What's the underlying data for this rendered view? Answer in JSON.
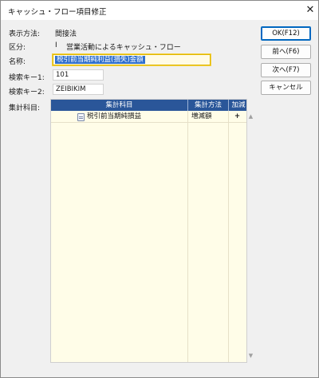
{
  "window": {
    "title": "キャッシュ・フロー項目修正",
    "close_label": "✕"
  },
  "form": {
    "display_method_label": "表示方法:",
    "display_method_value": "間接法",
    "category_label": "区分:",
    "category_code": "I",
    "category_value": "営業活動によるキャッシュ・フロー",
    "name_label": "名称:",
    "name_value": "税引前当期純利益(損失)金額",
    "search_key1_label": "検索キー1:",
    "search_key1_value": "101",
    "search_key2_label": "検索キー2:",
    "search_key2_value": "ZEIBIKIM",
    "aggregate_label": "集計科目:"
  },
  "buttons": {
    "ok": "OK(F12)",
    "prev": "前へ(F6)",
    "next": "次へ(F7)",
    "cancel": "キャンセル"
  },
  "table": {
    "columns": [
      "集計科目",
      "集計方法",
      "加減"
    ],
    "rows": [
      {
        "item": "税引前当期純損益",
        "method": "増減額",
        "sign": "+"
      }
    ]
  },
  "scroll": {
    "up": "▲",
    "down": "▼"
  }
}
